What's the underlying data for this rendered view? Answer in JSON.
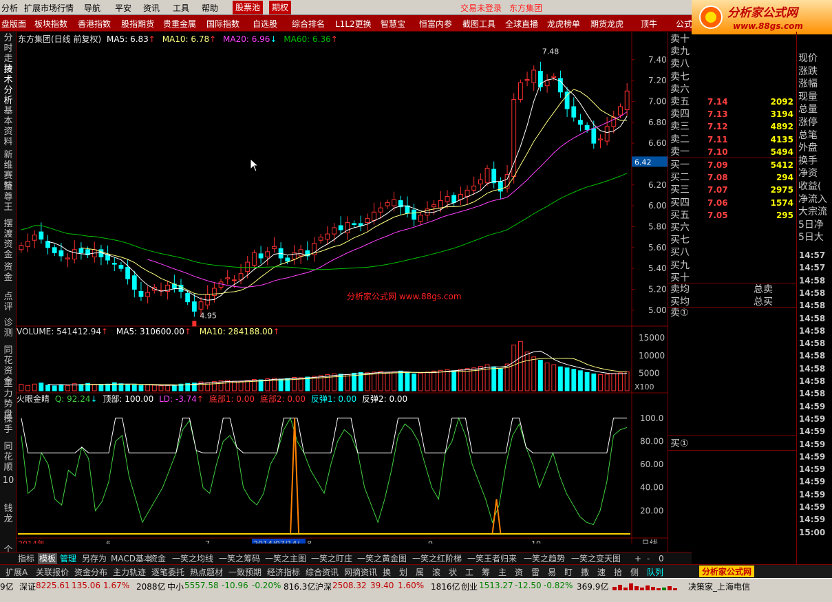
{
  "menubar": {
    "items": [
      "分析",
      "扩展市场行情",
      "导航",
      "平安",
      "资讯",
      "工具",
      "帮助"
    ],
    "tab_stock_pool": "股票池",
    "tab_futures": "期权",
    "status_login": "交易未登录",
    "status_stock": "东方集团"
  },
  "logo": {
    "text": "分析家公式网",
    "url": "www.88gs.com"
  },
  "toolbar": {
    "items": [
      "盘版面",
      "板块指数",
      "香港指数",
      "股指期货",
      "贵重金属",
      "国际指数",
      "自选股",
      "综合排名",
      "L1L2更换",
      "智慧宝",
      "恒富内参",
      "截图工具",
      "全球直播",
      "龙虎榜单",
      "期货龙虎",
      "顶牛",
      "公式"
    ]
  },
  "left_tabs": [
    "分时走势",
    "技术分析",
    "基本资料",
    "新维赛特",
    "至尊王",
    "摆渡资金",
    "资金",
    "点评",
    "诊测",
    "同花资金",
    "主力势盘",
    "操手",
    "同花顺",
    "10",
    "钱龙",
    "个股"
  ],
  "price_chart": {
    "title": "东方集团(日线 前复权)",
    "ma5_label": "MA5: 6.83",
    "ma10_label": "MA10: 6.78",
    "ma20_label": "MA20: 6.96",
    "ma60_label": "MA60: 6.36",
    "high_marker": "7.48",
    "low_marker": "4.95",
    "current_price_tag": "6.42",
    "watermark": "分析家公式网 www.88gs.com",
    "y_ticks": [
      "7.40",
      "7.20",
      "7.00",
      "6.80",
      "6.60",
      "6.40",
      "6.20",
      "6.00",
      "5.80",
      "5.60",
      "5.40",
      "5.20",
      "5.00"
    ]
  },
  "volume_chart": {
    "volume_label": "VOLUME: 541412.94",
    "ma5_label": "MA5: 310600.00",
    "ma10_label": "MA10: 284188.00",
    "y_ticks": [
      "15000",
      "10000",
      "5000"
    ],
    "unit": "X100"
  },
  "indicator_chart": {
    "name": "火眼金睛",
    "q_label": "Q: 92.24",
    "top_label": "顶部: 100.00",
    "ld_label": "LD: -3.74",
    "bottom1_label": "底部1: 0.00",
    "bottom2_label": "底部2: 0.00",
    "rebound1_label": "反弹1: 0.00",
    "rebound2_label": "反弹2: 0.00",
    "y_ticks": [
      "100.0",
      "80.00",
      "60.00",
      "40.00",
      "20.00"
    ]
  },
  "time_axis": {
    "labels": [
      "2014年",
      "6",
      "7",
      "2014/07/14/—",
      "8",
      "9",
      "10"
    ],
    "period": "日线"
  },
  "orderbook": {
    "sells": [
      {
        "label": "卖十",
        "price": "",
        "vol": ""
      },
      {
        "label": "卖九",
        "price": "",
        "vol": ""
      },
      {
        "label": "卖八",
        "price": "",
        "vol": ""
      },
      {
        "label": "卖七",
        "price": "",
        "vol": ""
      },
      {
        "label": "卖六",
        "price": "",
        "vol": ""
      },
      {
        "label": "卖五",
        "price": "7.14",
        "vol": "2092"
      },
      {
        "label": "卖四",
        "price": "7.13",
        "vol": "3194"
      },
      {
        "label": "卖三",
        "price": "7.12",
        "vol": "4892"
      },
      {
        "label": "卖二",
        "price": "7.11",
        "vol": "4135"
      },
      {
        "label": "卖一",
        "price": "7.10",
        "vol": "5494"
      }
    ],
    "buys": [
      {
        "label": "买一",
        "price": "7.09",
        "vol": "5412"
      },
      {
        "label": "买二",
        "price": "7.08",
        "vol": "294"
      },
      {
        "label": "买三",
        "price": "7.07",
        "vol": "2975"
      },
      {
        "label": "买四",
        "price": "7.06",
        "vol": "1574"
      },
      {
        "label": "买五",
        "price": "7.05",
        "vol": "295"
      },
      {
        "label": "买六",
        "price": "",
        "vol": ""
      },
      {
        "label": "买七",
        "price": "",
        "vol": ""
      },
      {
        "label": "买八",
        "price": "",
        "vol": ""
      },
      {
        "label": "买九",
        "price": "",
        "vol": ""
      },
      {
        "label": "买十",
        "price": "",
        "vol": ""
      }
    ],
    "sell_avg": "卖均",
    "buy_avg": "买均",
    "total_sell": "总卖",
    "total_buy": "总买",
    "sell_queue": "卖①",
    "buy_queue": "买①"
  },
  "right_column": {
    "items": [
      "现价",
      "涨跌",
      "涨幅",
      "现量",
      "总量",
      "涨停",
      "总笔",
      "外盘",
      "换手",
      "净资",
      "收益(",
      "净流入",
      "大宗流",
      "5日净",
      "5日大"
    ],
    "times": [
      "14:57",
      "14:57",
      "14:58",
      "14:58",
      "14:58",
      "14:58",
      "14:58",
      "14:58",
      "14:58",
      "14:58",
      "14:58",
      "14:58",
      "14:59",
      "14:59",
      "14:59",
      "14:59",
      "14:59",
      "14:59",
      "14:59",
      "14:59",
      "14:59",
      "14:59",
      "15:00"
    ]
  },
  "bottom_tabs": [
    "指标",
    "模板",
    "管理",
    "另存为",
    "MACD基本",
    "资金",
    "一笑之均线",
    "一笑之筹码",
    "一笑之主图",
    "一笑之盯庄",
    "一笑之黄金图",
    "一笑之红阶梯",
    "一笑王者归来",
    "一笑之趋势",
    "一笑之变天图",
    "+",
    "-",
    "0"
  ],
  "quick_bar": [
    "扩展A",
    "关联报价",
    "资金分布",
    "主力轨迹",
    "逐笔委托",
    "热点题材",
    "一致预期",
    "经济指标",
    "综合资讯",
    "网摘资讯",
    "换",
    "划",
    "属",
    "滚",
    "状",
    "工",
    "筹",
    "主",
    "资",
    "雷",
    "易",
    "盯",
    "撒",
    "速",
    "拾",
    "侧",
    "队列"
  ],
  "status": {
    "lead": "9亿",
    "sz_label": "深证",
    "sz_index": "8225.61",
    "sz_change": "135.06",
    "sz_pct": "1.67%",
    "sz_amount": "2088亿",
    "zx_label": "中小",
    "zx_index": "5557.58",
    "zx_change": "-10.96",
    "zx_pct": "-0.20%",
    "zx_amount": "816.3亿",
    "hs_label": "沪深",
    "hs_index": "2508.32",
    "hs_change": "39.40",
    "hs_pct": "1.60%",
    "hs_amount": "1816亿",
    "cy_label": "创业",
    "cy_index": "1513.27",
    "cy_change": "-12.50",
    "cy_pct": "-0.82%",
    "cy_amount": "369.9亿",
    "right_text": "决策家_上海电信"
  },
  "colors": {
    "up": "#ff3030",
    "down": "#00ffff",
    "ma5": "#ffffff",
    "ma10": "#ffff80",
    "ma20": "#ff40ff",
    "ma60": "#00c000",
    "indicator": "#40d040",
    "top_line": "#ffffff",
    "signal": "#ff8000"
  },
  "chart_data": {
    "type": "candlestick",
    "period": "daily",
    "ylim": [
      4.9,
      7.55
    ],
    "closes": [
      5.62,
      5.66,
      5.72,
      5.68,
      5.6,
      5.55,
      5.52,
      5.5,
      5.58,
      5.55,
      5.53,
      5.58,
      5.51,
      5.48,
      5.44,
      5.4,
      5.3,
      5.2,
      5.13,
      5.17,
      5.22,
      5.19,
      5.24,
      5.21,
      5.18,
      5.08,
      4.99,
      5.08,
      5.15,
      5.21,
      5.27,
      5.31,
      5.29,
      5.35,
      5.46,
      5.55,
      5.5,
      5.56,
      5.61,
      5.5,
      5.47,
      5.55,
      5.58,
      5.52,
      5.64,
      5.7,
      5.73,
      5.79,
      5.77,
      5.84,
      5.82,
      5.81,
      5.88,
      5.94,
      5.98,
      6.03,
      6.06,
      5.99,
      5.93,
      5.87,
      5.91,
      5.97,
      6.01,
      6.05,
      6.09,
      6.03,
      6.11,
      6.15,
      6.19,
      6.25,
      6.36,
      6.22,
      6.14,
      6.3,
      7.02,
      7.18,
      7.21,
      7.3,
      7.14,
      7.2,
      7.24,
      7.09,
      6.93,
      6.85,
      6.78,
      6.73,
      6.6,
      6.64,
      6.76,
      6.85,
      6.95,
      7.1
    ],
    "volume": [
      1800,
      1500,
      1900,
      2200,
      1600,
      1400,
      1700,
      1500,
      2000,
      1800,
      2100,
      1700,
      1600,
      1900,
      2300,
      2000,
      1800,
      1600,
      1500,
      1700,
      1600,
      1400,
      1500,
      1600,
      1900,
      2100,
      2200,
      2500,
      2300,
      2600,
      2800,
      3000,
      2700,
      2600,
      2900,
      3200,
      3100,
      3400,
      3600,
      3300,
      3500,
      3800,
      3700,
      3900,
      4100,
      4300,
      4600,
      4800,
      4700,
      4600,
      5000,
      5200,
      5100,
      5300,
      5500,
      5200,
      5400,
      5600,
      5100,
      4800,
      5000,
      5300,
      5600,
      5800,
      6000,
      5700,
      6100,
      6300,
      6500,
      6900,
      7400,
      6800,
      6200,
      7600,
      13000,
      14000,
      11000,
      9600,
      8700,
      7900,
      7400,
      6800,
      6500,
      6100,
      5700,
      5200,
      4800,
      4600,
      4700,
      4900,
      5100,
      5400
    ],
    "indicator_q": [
      85,
      35,
      40,
      70,
      60,
      30,
      25,
      55,
      50,
      75,
      65,
      20,
      28,
      45,
      80,
      85,
      50,
      30,
      10,
      20,
      30,
      40,
      55,
      70,
      90,
      98,
      72,
      40,
      35,
      60,
      80,
      85,
      75,
      40,
      30,
      25,
      35,
      60,
      70,
      90,
      100,
      80,
      70,
      55,
      45,
      35,
      60,
      80,
      90,
      85,
      70,
      40,
      25,
      10,
      30,
      55,
      85,
      95,
      90,
      80,
      60,
      40,
      30,
      70,
      80,
      100,
      85,
      60,
      45,
      30,
      10,
      25,
      60,
      85,
      95,
      75,
      60,
      40,
      55,
      70,
      50,
      35,
      25,
      15,
      10,
      8,
      20,
      45,
      85,
      90,
      92
    ]
  }
}
